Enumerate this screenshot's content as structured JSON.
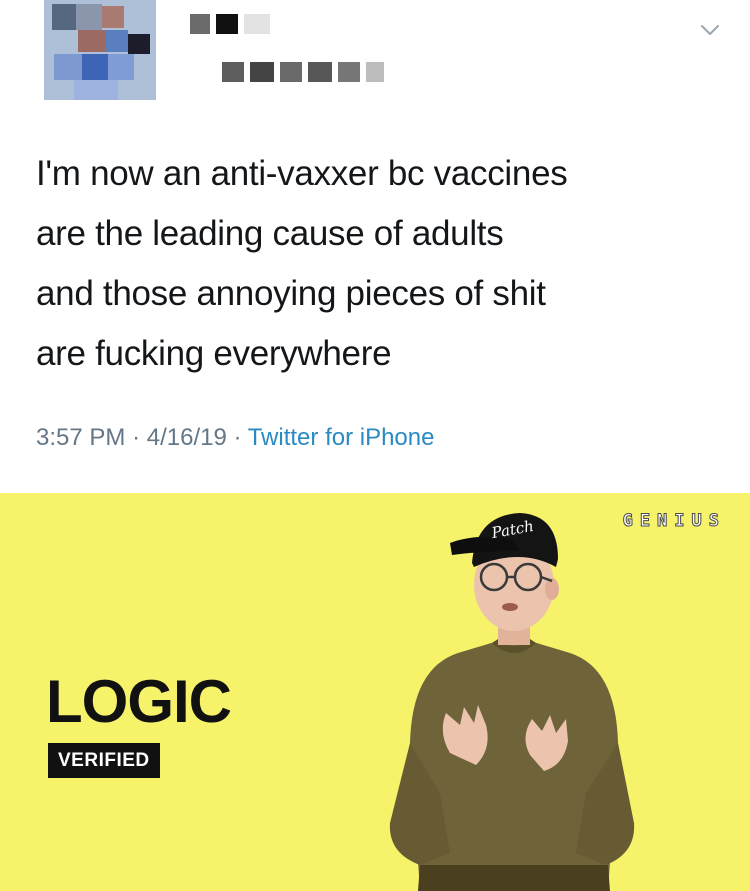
{
  "tweet": {
    "text_lines": [
      "I'm now an anti-vaxxer bc vaccines",
      "are the leading cause of adults",
      "and those annoying pieces of shit",
      "are fucking everywhere"
    ],
    "time": "3:57 PM",
    "separator": "·",
    "date": "4/16/19",
    "source": "Twitter for iPhone",
    "menu_icon": "chevron-down-icon",
    "avatar": "pixelated-avatar"
  },
  "genius": {
    "logo": "GENIUS",
    "artist": "LOGIC",
    "badge": "VERIFIED",
    "cap_text": "Patch",
    "background_color": "#f6f26a"
  }
}
